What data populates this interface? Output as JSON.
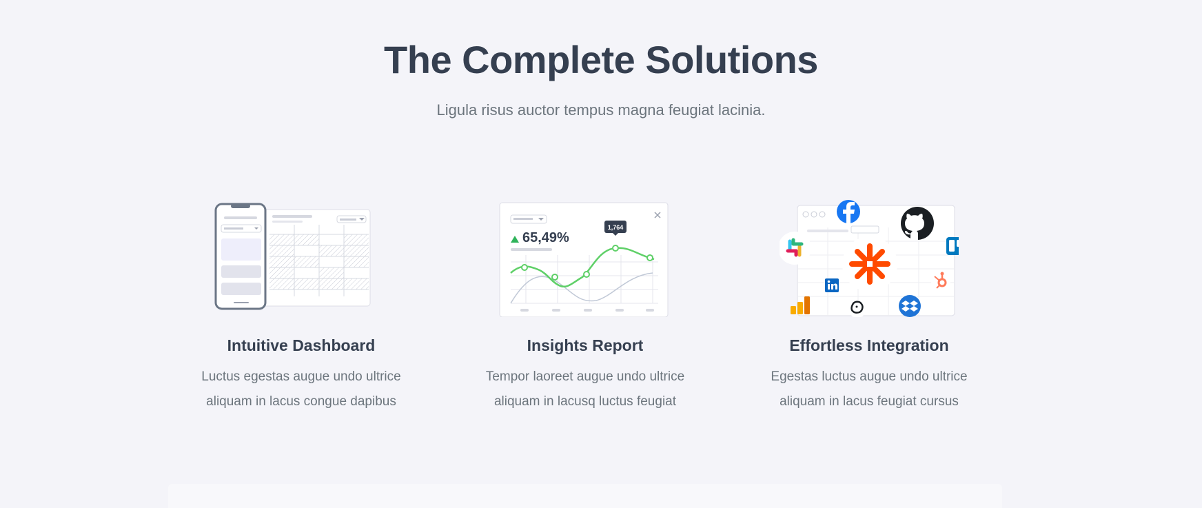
{
  "section": {
    "title": "The Complete Solutions",
    "subtitle": "Ligula risus auctor tempus magna feugiat lacinia."
  },
  "features": [
    {
      "title": "Intuitive Dashboard",
      "line1": "Luctus egestas augue undo ultrice",
      "line2": "aliquam in lacus congue dapibus",
      "illustration": "dashboard-phone-table"
    },
    {
      "title": "Insights Report",
      "line1": "Tempor laoreet augue undo ultrice",
      "line2": "aliquam in lacusq luctus feugiat",
      "illustration": "line-chart-report",
      "chart": {
        "stat": "65,49%",
        "tooltip": "1,764"
      }
    },
    {
      "title": "Effortless Integration",
      "line1": "Egestas luctus augue undo ultrice",
      "line2": "aliquam in lacus feugiat cursus",
      "illustration": "integration-logos",
      "icons": [
        "zapier-icon",
        "facebook-icon",
        "github-icon",
        "slack-icon",
        "trello-icon",
        "hubspot-icon",
        "linkedin-icon",
        "mailchimp-icon",
        "dropbox-icon",
        "google-analytics-icon"
      ]
    }
  ],
  "colors": {
    "background": "#f4f4f9",
    "heading": "#353f50",
    "body": "#6c757d",
    "accent_green": "#5fd068",
    "zapier": "#ff4a00",
    "facebook": "#1877f2",
    "trello": "#0079bf",
    "dropbox": "#0061fe"
  }
}
